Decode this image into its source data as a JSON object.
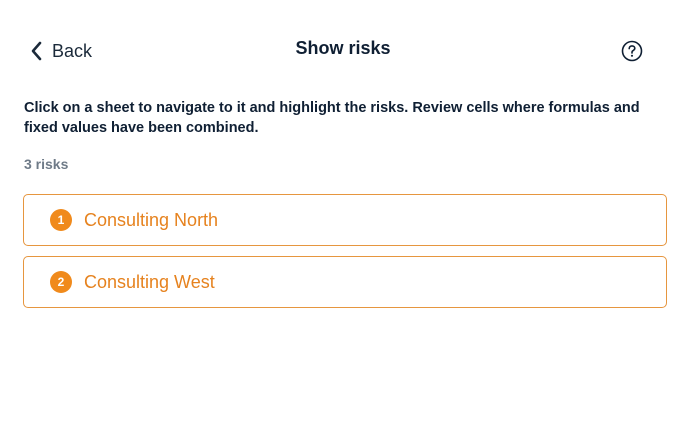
{
  "header": {
    "back_label": "Back",
    "title": "Show risks",
    "back_icon": "chevron-left-icon",
    "help_icon": "question-circle-icon"
  },
  "main": {
    "description": "Click on a sheet to navigate to it and highlight the risks. Review cells where formulas and fixed values have been combined.",
    "count_label": "3 risks",
    "risks": [
      {
        "number": "1",
        "label": "Consulting North"
      },
      {
        "number": "2",
        "label": "Consulting West"
      }
    ]
  },
  "colors": {
    "accent": "#f08a1c",
    "accent_text": "#e6821e",
    "border": "#e6963f",
    "heading": "#0f1f33",
    "muted": "#6f7b88"
  }
}
